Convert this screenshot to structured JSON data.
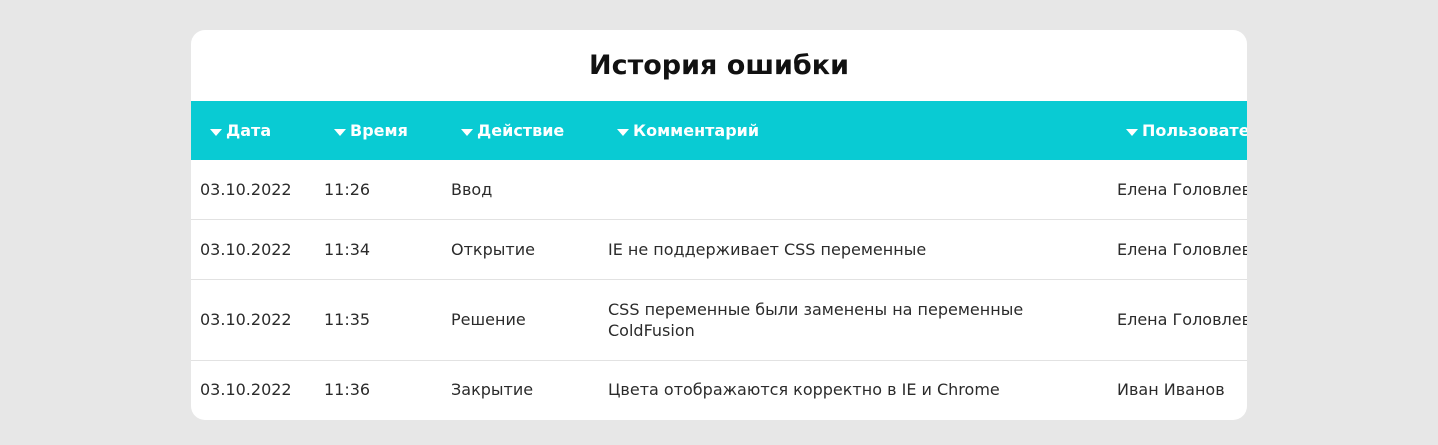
{
  "title": "История ошибки",
  "colors": {
    "page_background": "#e7e7e7",
    "card_background": "#ffffff",
    "header_background": "#09cbd3",
    "header_text": "#ffffff",
    "row_divider": "#e2e2e2"
  },
  "table": {
    "columns": [
      {
        "label": "Дата",
        "icon": "sort-down-icon"
      },
      {
        "label": "Время",
        "icon": "sort-down-icon"
      },
      {
        "label": "Действие",
        "icon": "sort-down-icon"
      },
      {
        "label": "Комментарий",
        "icon": "sort-down-icon"
      },
      {
        "label": "Пользователь",
        "icon": "sort-down-icon"
      }
    ],
    "rows": [
      {
        "date": "03.10.2022",
        "time": "11:26",
        "action": "Ввод",
        "comment": "",
        "user": "Елена Головлева"
      },
      {
        "date": "03.10.2022",
        "time": "11:34",
        "action": "Открытие",
        "comment": "IE не поддерживает CSS переменные",
        "user": "Елена Головлева"
      },
      {
        "date": "03.10.2022",
        "time": "11:35",
        "action": "Решение",
        "comment": "CSS переменные были заменены на переменные ColdFusion",
        "user": "Елена Головлева"
      },
      {
        "date": "03.10.2022",
        "time": "11:36",
        "action": "Закрытие",
        "comment": "Цвета отображаются корректно в IE и Chrome",
        "user": "Иван Иванов"
      }
    ]
  }
}
